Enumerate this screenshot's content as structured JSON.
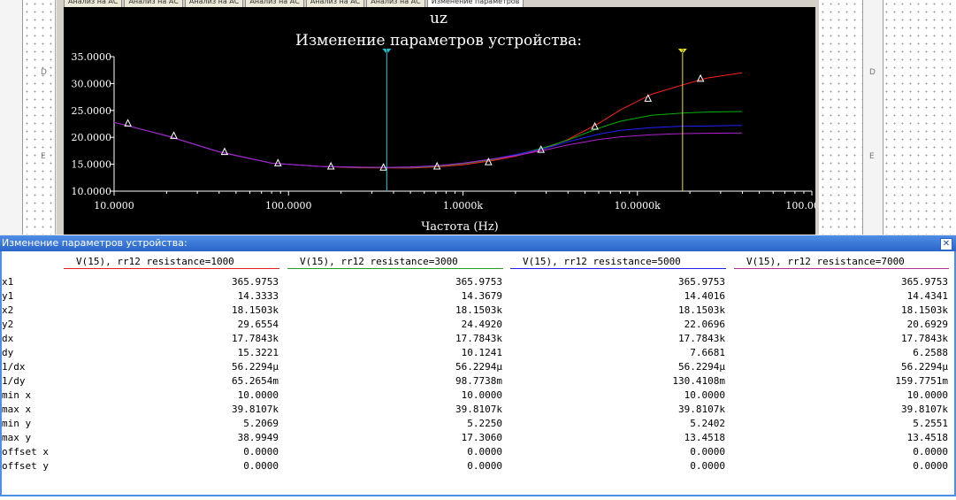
{
  "tabs": [
    "Анализ на АС",
    "Анализ на АС",
    "Анализ на АС",
    "Анализ на АС",
    "Анализ на АС",
    "Анализ на АС",
    "Изменение параметров"
  ],
  "background_letters": [
    "D",
    "E",
    "D",
    "E"
  ],
  "chart_data": {
    "type": "line",
    "title": "Изменение параметров устройства:",
    "subtitle": "uz",
    "xlabel": "Частота (Hz)",
    "ylabel": "",
    "xscale": "log",
    "xlim": [
      10,
      100000
    ],
    "ylim": [
      10,
      35
    ],
    "xticks": [
      "10.0000",
      "100.0000",
      "1.0000k",
      "10.0000k",
      "100.0000k"
    ],
    "yticks": [
      "10.0000",
      "15.0000",
      "20.0000",
      "25.0000",
      "30.0000",
      "35.0000"
    ],
    "grid": false,
    "background": "#000000",
    "x": [
      10,
      20,
      40,
      80,
      150,
      250,
      365,
      500,
      700,
      1000,
      1500,
      2000,
      3000,
      4000,
      6000,
      8000,
      12000,
      18000,
      25000,
      39800
    ],
    "series": [
      {
        "color": "#ff2020",
        "values": [
          22.8,
          20.3,
          17.3,
          15.2,
          14.6,
          14.35,
          14.33,
          14.3,
          14.5,
          14.9,
          15.7,
          16.5,
          18.0,
          19.6,
          22.6,
          25.1,
          28.0,
          29.7,
          31.0,
          32.0
        ]
      },
      {
        "color": "#00b000",
        "values": [
          22.8,
          20.3,
          17.3,
          15.2,
          14.6,
          14.4,
          14.37,
          14.4,
          14.6,
          15.1,
          15.9,
          16.7,
          18.2,
          19.5,
          21.7,
          23.0,
          24.1,
          24.5,
          24.7,
          24.8
        ]
      },
      {
        "color": "#2020ff",
        "values": [
          22.8,
          20.3,
          17.3,
          15.2,
          14.6,
          14.45,
          14.4,
          14.45,
          14.7,
          15.2,
          16.0,
          16.8,
          18.0,
          19.2,
          20.6,
          21.3,
          21.8,
          22.07,
          22.1,
          22.2
        ]
      },
      {
        "color": "#b020d0",
        "values": [
          22.8,
          20.3,
          17.3,
          15.2,
          14.6,
          14.45,
          14.43,
          14.5,
          14.7,
          15.2,
          16.0,
          16.6,
          17.7,
          18.6,
          19.6,
          20.1,
          20.5,
          20.69,
          20.75,
          20.8
        ]
      }
    ],
    "marker_points": [
      {
        "x": 12,
        "y": 22.6
      },
      {
        "x": 22,
        "y": 20.3
      },
      {
        "x": 43,
        "y": 17.3
      },
      {
        "x": 87,
        "y": 15.2
      },
      {
        "x": 175,
        "y": 14.6
      },
      {
        "x": 350,
        "y": 14.4
      },
      {
        "x": 710,
        "y": 14.6
      },
      {
        "x": 1400,
        "y": 15.4
      },
      {
        "x": 2800,
        "y": 17.7
      },
      {
        "x": 5700,
        "y": 22.0
      },
      {
        "x": 11500,
        "y": 27.2
      },
      {
        "x": 23000,
        "y": 30.9
      }
    ],
    "cursors": [
      {
        "x": 365.9753,
        "color": "#20c0d0"
      },
      {
        "x": 18150.3,
        "color": "#e8e020"
      }
    ]
  },
  "results": {
    "title": "Изменение параметров устройства:",
    "close_label": "✕",
    "columns": [
      {
        "header": "V(15), rr12 resistance=1000",
        "color": "#e02020"
      },
      {
        "header": "V(15), rr12 resistance=3000",
        "color": "#20a020"
      },
      {
        "header": "V(15), rr12 resistance=5000",
        "color": "#2020e0"
      },
      {
        "header": "V(15), rr12 resistance=7000",
        "color": "#b03090"
      }
    ],
    "rows": [
      {
        "label": "x1",
        "values": [
          "365.9753",
          "365.9753",
          "365.9753",
          "365.9753"
        ]
      },
      {
        "label": "y1",
        "values": [
          "14.3333",
          "14.3679",
          "14.4016",
          "14.4341"
        ]
      },
      {
        "label": "x2",
        "values": [
          "18.1503k",
          "18.1503k",
          "18.1503k",
          "18.1503k"
        ]
      },
      {
        "label": "y2",
        "values": [
          "29.6554",
          "24.4920",
          "22.0696",
          "20.6929"
        ]
      },
      {
        "label": "dx",
        "values": [
          "17.7843k",
          "17.7843k",
          "17.7843k",
          "17.7843k"
        ]
      },
      {
        "label": "dy",
        "values": [
          "15.3221",
          "10.1241",
          "7.6681",
          "6.2588"
        ]
      },
      {
        "label": "1/dx",
        "values": [
          "56.2294µ",
          "56.2294µ",
          "56.2294µ",
          "56.2294µ"
        ]
      },
      {
        "label": "1/dy",
        "values": [
          "65.2654m",
          "98.7738m",
          "130.4108m",
          "159.7751m"
        ]
      },
      {
        "label": "min x",
        "values": [
          "10.0000",
          "10.0000",
          "10.0000",
          "10.0000"
        ]
      },
      {
        "label": "max x",
        "values": [
          "39.8107k",
          "39.8107k",
          "39.8107k",
          "39.8107k"
        ]
      },
      {
        "label": "min y",
        "values": [
          "5.2069",
          "5.2250",
          "5.2402",
          "5.2551"
        ]
      },
      {
        "label": "max y",
        "values": [
          "38.9949",
          "17.3060",
          "13.4518",
          "13.4518"
        ]
      },
      {
        "label": "offset x",
        "values": [
          "0.0000",
          "0.0000",
          "0.0000",
          "0.0000"
        ]
      },
      {
        "label": "offset y",
        "values": [
          "0.0000",
          "0.0000",
          "0.0000",
          "0.0000"
        ]
      }
    ]
  }
}
